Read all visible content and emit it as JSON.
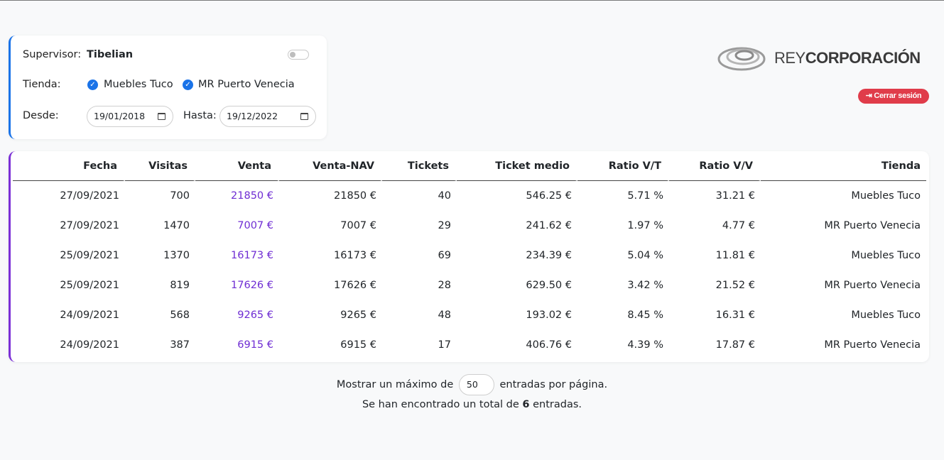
{
  "filters": {
    "supervisor_label": "Supervisor:",
    "supervisor_name": "Tibelian",
    "tienda_label": "Tienda:",
    "stores": [
      "Muebles Tuco",
      "MR Puerto Venecia"
    ],
    "desde_label": "Desde:",
    "desde_value": "19/01/2018",
    "hasta_label": "Hasta:",
    "hasta_value": "19/12/2022"
  },
  "brand": {
    "logo_prefix": "REY",
    "logo_suffix": "CORPORACIÓN",
    "logout_label": "Cerrar sesión"
  },
  "table": {
    "headers": [
      "Fecha",
      "Visitas",
      "Venta",
      "Venta-NAV",
      "Tickets",
      "Ticket medio",
      "Ratio V/T",
      "Ratio V/V",
      "Tienda"
    ],
    "rows": [
      [
        "27/09/2021",
        "700",
        "21850 €",
        "21850 €",
        "40",
        "546.25 €",
        "5.71 %",
        "31.21 €",
        "Muebles Tuco"
      ],
      [
        "27/09/2021",
        "1470",
        "7007 €",
        "7007 €",
        "29",
        "241.62 €",
        "1.97 %",
        "4.77 €",
        "MR Puerto Venecia"
      ],
      [
        "25/09/2021",
        "1370",
        "16173 €",
        "16173 €",
        "69",
        "234.39 €",
        "5.04 %",
        "11.81 €",
        "Muebles Tuco"
      ],
      [
        "25/09/2021",
        "819",
        "17626 €",
        "17626 €",
        "28",
        "629.50 €",
        "3.42 %",
        "21.52 €",
        "MR Puerto Venecia"
      ],
      [
        "24/09/2021",
        "568",
        "9265 €",
        "9265 €",
        "48",
        "193.02 €",
        "8.45 %",
        "16.31 €",
        "Muebles Tuco"
      ],
      [
        "24/09/2021",
        "387",
        "6915 €",
        "6915 €",
        "17",
        "406.76 €",
        "4.39 %",
        "17.87 €",
        "MR Puerto Venecia"
      ]
    ]
  },
  "footer": {
    "show_prefix": "Mostrar un máximo de",
    "page_size": "50",
    "show_suffix": "entradas por página.",
    "total_prefix": "Se han encontrado un total de",
    "total_count": "6",
    "total_suffix": "entradas."
  }
}
